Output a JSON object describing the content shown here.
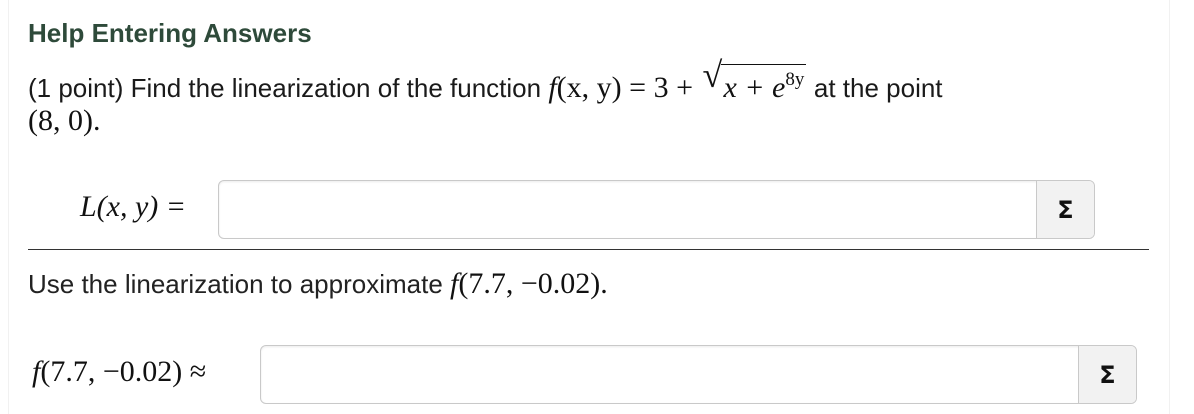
{
  "help": {
    "link_label": "Help Entering Answers"
  },
  "problem": {
    "intro": "(1 point) Find the linearization of the function",
    "func_name": "f",
    "func_args": "(x, y)",
    "equals_three_plus": " = 3 + ",
    "radicand_base": "x + e",
    "radicand_exponent": "8y",
    "after_function": "at the point",
    "point": "(8, 0)",
    "period": "."
  },
  "answer1": {
    "label": "L(x, y) =",
    "value": "",
    "placeholder": "",
    "sigma_label": "Σ"
  },
  "part2": {
    "text": "Use the linearization to approximate",
    "func_name": "f",
    "func_args": "(7.7, −0.02)",
    "period": "."
  },
  "answer2": {
    "label_func": "f",
    "label_args": "(7.7, −0.02) ≈",
    "value": "",
    "placeholder": "",
    "sigma_label": "Σ"
  },
  "colors": {
    "help_link": "#2e4a3a",
    "input_border": "#c9c9c9",
    "sigma_bg": "#f2f2f2",
    "divider": "#333333"
  },
  "icons": {
    "answer1_sigma": "sigma-icon",
    "answer2_sigma": "sigma-icon"
  }
}
